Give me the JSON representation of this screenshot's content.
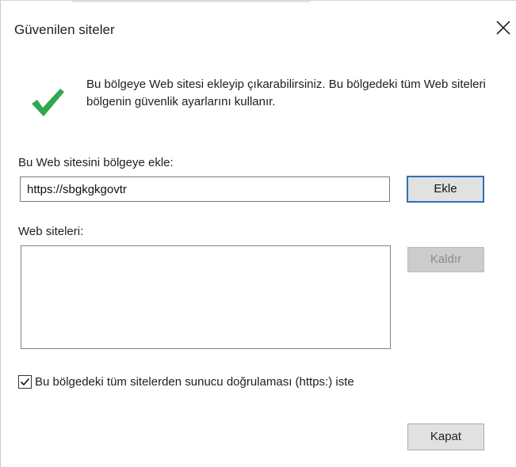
{
  "dialog": {
    "title": "Güvenilen siteler",
    "info_text": "Bu bölgeye Web sitesi ekleyip çıkarabilirsiniz. Bu bölgedeki tüm Web siteleri bölgenin güvenlik ayarlarını kullanır.",
    "add_label": "Bu Web sitesini bölgeye ekle:",
    "url_value": "https://sbgkgkgovtr",
    "add_button": "Ekle",
    "sites_label": "Web siteleri:",
    "sites": [],
    "remove_button": "Kaldır",
    "https_checkbox_label": "Bu bölgedeki tüm sitelerden sunucu doğrulaması (https:) iste",
    "https_checked": true,
    "close_button": "Kapat"
  },
  "icons": {
    "close": "close-icon",
    "status": "checkmark-icon",
    "checkbox": "checkbox-checked-icon"
  },
  "colors": {
    "checkmark": "#2fa84f",
    "focus_border": "#2f6fb7",
    "disabled_text": "#8b8b8b"
  }
}
